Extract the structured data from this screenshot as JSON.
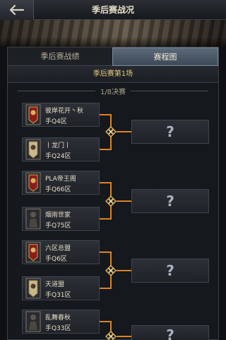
{
  "header": {
    "title": "季后赛战况",
    "back_icon": "back-arrow-icon"
  },
  "tabs": [
    {
      "label": "季后赛战绩",
      "active": false
    },
    {
      "label": "赛程图",
      "active": true
    }
  ],
  "match": {
    "label": "季后赛第1场"
  },
  "round": {
    "label": "1/8决赛"
  },
  "colors": {
    "accent": "#d9832a",
    "match_text": "#e8c878"
  },
  "teams": [
    {
      "name": "彼岸花开丶秋",
      "zone": "手Q4区",
      "emblem": "red-banner-emblem"
    },
    {
      "name": "丨龙门丨",
      "zone": "手Q24区",
      "emblem": "gold-banner-emblem"
    },
    {
      "name": "PLA帝王阁",
      "zone": "手Q66区",
      "emblem": "red-banner-emblem"
    },
    {
      "name": "烟雨世家",
      "zone": "手Q75区",
      "emblem": "dark-warrior-emblem"
    },
    {
      "name": "六区总盟",
      "zone": "手Q6区",
      "emblem": "red-banner-emblem"
    },
    {
      "name": "天道盟",
      "zone": "手Q31区",
      "emblem": "gold-banner-emblem"
    },
    {
      "name": "乱舞春秋",
      "zone": "手Q33区",
      "emblem": "dark-warrior-emblem"
    }
  ],
  "results": [
    {
      "label": "?"
    },
    {
      "label": "?"
    },
    {
      "label": "?"
    },
    {
      "label": "?"
    }
  ]
}
